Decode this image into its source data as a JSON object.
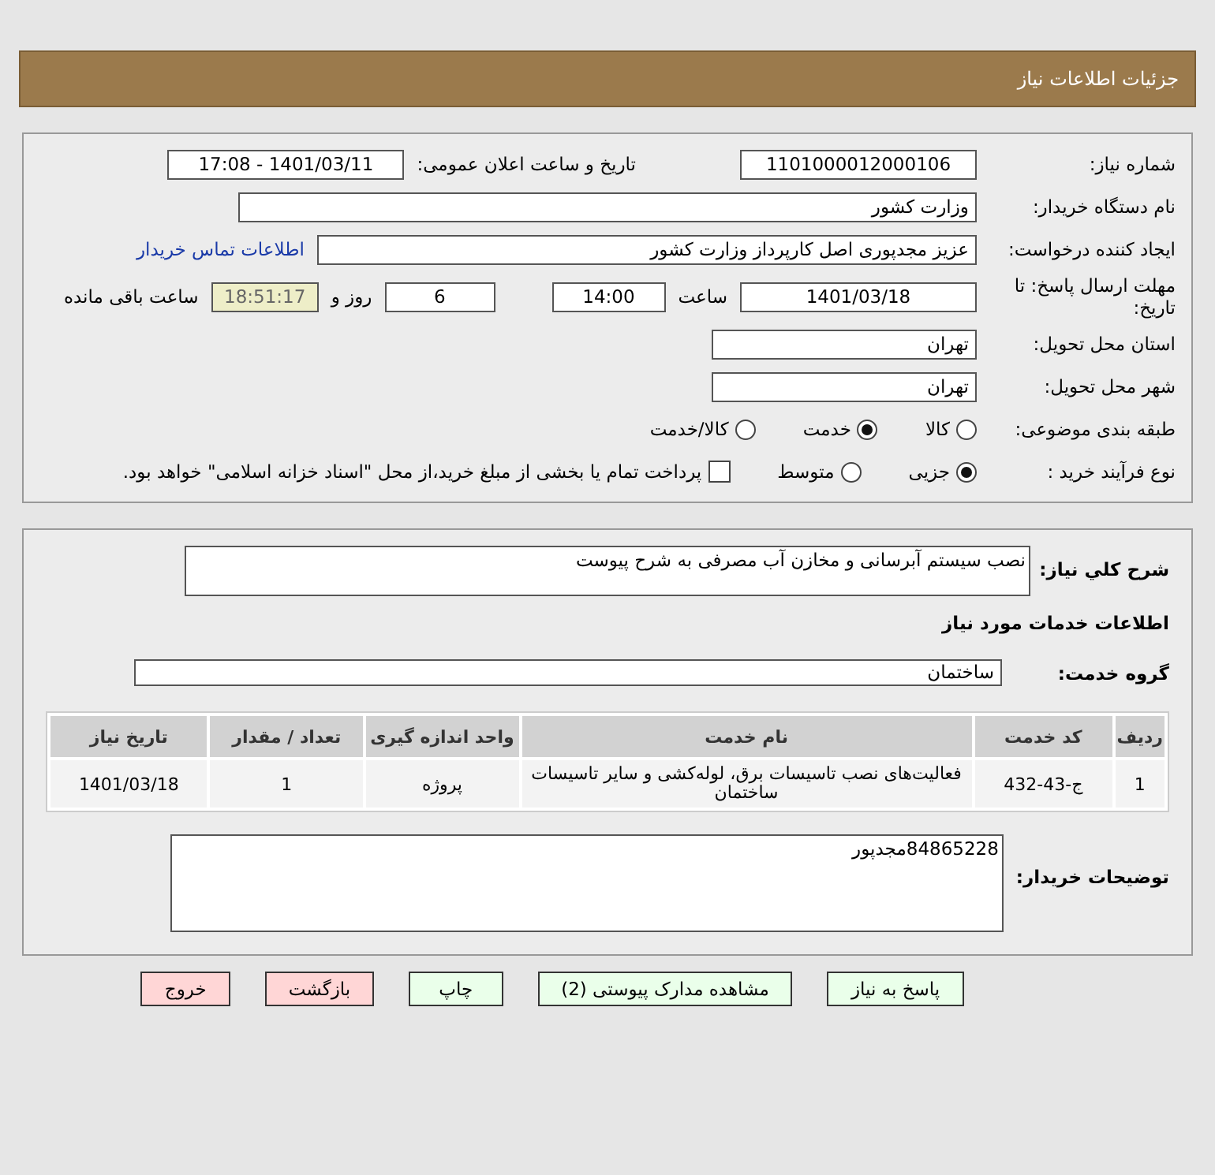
{
  "header": {
    "title": "جزئیات اطلاعات نیاز"
  },
  "info": {
    "need_number": {
      "label": "شماره نیاز:",
      "value": "1101000012000106"
    },
    "announce": {
      "label": "تاریخ و ساعت اعلان عمومی:",
      "value": "1401/03/11 - 17:08"
    },
    "buyer_org": {
      "label": "نام دستگاه خریدار:",
      "value": "وزارت کشور"
    },
    "creator": {
      "label": "ایجاد کننده درخواست:",
      "value": "عزیز مجدپوری اصل کارپرداز وزارت کشور",
      "link": "اطلاعات تماس خریدار"
    },
    "deadline": {
      "label": "مهلت ارسال پاسخ: تا تاریخ:",
      "date": "1401/03/18",
      "time_label": "ساعت",
      "time": "14:00",
      "days": "6",
      "days_label": "روز و",
      "remaining": "18:51:17",
      "remaining_label": "ساعت باقی مانده"
    },
    "province": {
      "label": "استان محل تحویل:",
      "value": "تهران"
    },
    "city": {
      "label": "شهر محل تحویل:",
      "value": "تهران"
    },
    "category": {
      "label": "طبقه بندی موضوعی:",
      "options": [
        {
          "label": "کالا",
          "selected": false
        },
        {
          "label": "خدمت",
          "selected": true
        },
        {
          "label": "کالا/خدمت",
          "selected": false
        }
      ]
    },
    "process": {
      "label": "نوع فرآیند خرید :",
      "options": [
        {
          "label": "جزیی",
          "selected": true
        },
        {
          "label": "متوسط",
          "selected": false
        }
      ],
      "treasury": {
        "label": "پرداخت تمام یا بخشی از مبلغ خرید،از محل \"اسناد خزانه اسلامی\" خواهد بود.",
        "checked": false
      }
    }
  },
  "details": {
    "summary": {
      "label": "شرح کلي نیاز:",
      "value": "نصب سیستم آبرسانی و مخازن آب مصرفی به شرح پیوست"
    },
    "services_title": "اطلاعات خدمات مورد نیاز",
    "service_group": {
      "label": "گروه خدمت:",
      "value": "ساختمان"
    },
    "table": {
      "columns": [
        "ردیف",
        "کد خدمت",
        "نام خدمت",
        "واحد اندازه گیری",
        "تعداد / مقدار",
        "تاریخ نیاز"
      ],
      "rows": [
        [
          "1",
          "ج-43-432",
          "فعالیت‌های نصب تاسیسات برق، لوله‌کشی و سایر تاسیسات ساختمان",
          "پروژه",
          "1",
          "1401/03/18"
        ]
      ]
    },
    "notes": {
      "label": "توضیحات خریدار:",
      "value": "84865228مجدپور"
    }
  },
  "buttons": [
    {
      "label": "پاسخ به نیاز",
      "kind": "primary"
    },
    {
      "label": "مشاهده مدارک پیوستی (2)",
      "kind": "primary"
    },
    {
      "label": "چاپ",
      "kind": "primary"
    },
    {
      "label": "بازگشت",
      "kind": "danger"
    },
    {
      "label": "خروج",
      "kind": "danger"
    }
  ]
}
